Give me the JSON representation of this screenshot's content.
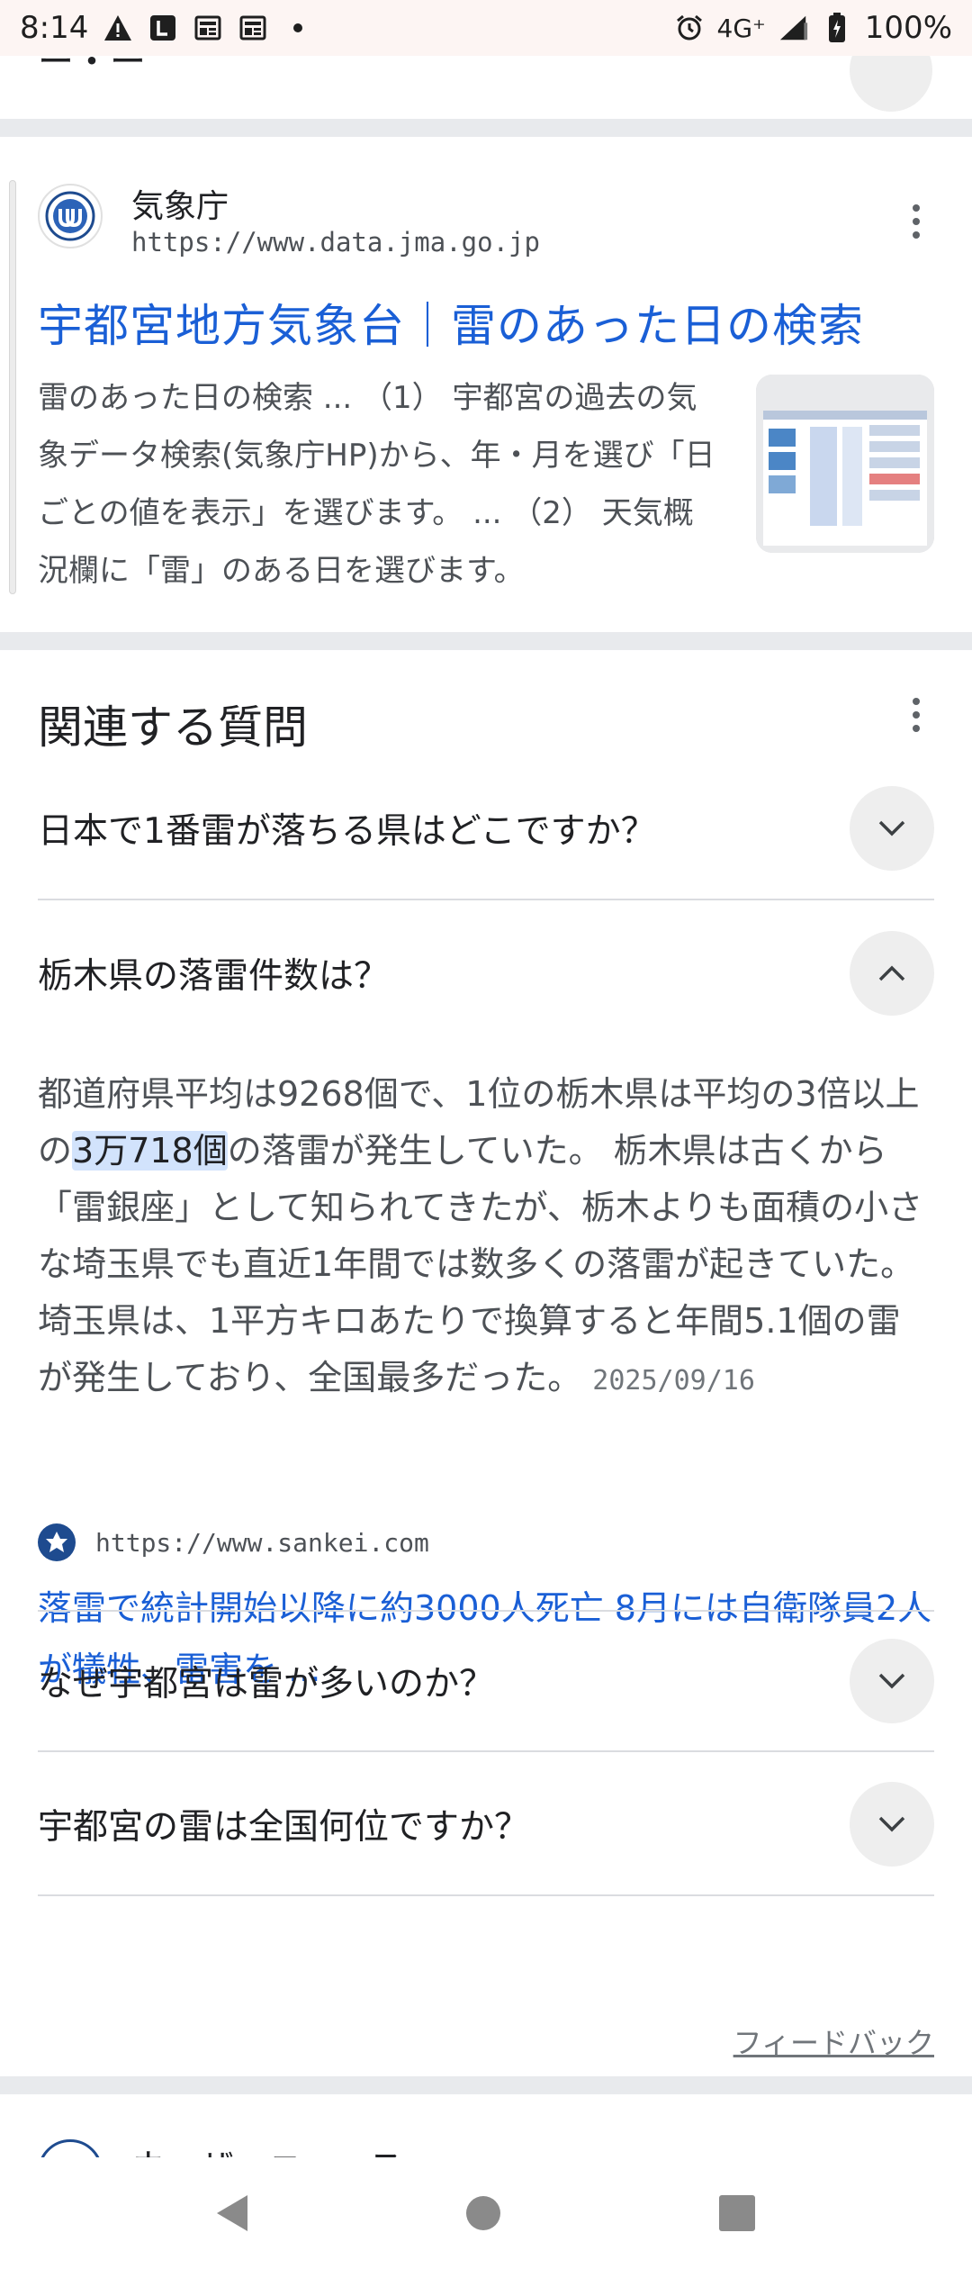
{
  "status_bar": {
    "time": "8:14",
    "network": "4G⁺",
    "battery": "100%"
  },
  "colors": {
    "link_blue": "#1a5fd6",
    "status_bg": "#fdf5f3",
    "separator": "#e8eaed",
    "highlight": "#d2e3fc"
  },
  "top_card": {
    "cut_title": "ー・ー"
  },
  "result": {
    "site_name": "気象庁",
    "site_url": "https://www.data.jma.go.jp",
    "title": "宇都宮地方気象台｜雷のあった日の検索",
    "snippet": "雷のあった日の検索 ... （1） 宇都宮の過去の気象データ検索(気象庁HP)から、年・月を選び「日ごとの値を表示」を選びます。 ... （2） 天気概況欄に「雷」のある日を選びます。"
  },
  "related": {
    "title": "関連する質問",
    "questions": [
      {
        "text": "日本で1番雷が落ちる県はどこですか？",
        "expanded": false
      },
      {
        "text": "栃木県の落雷件数は？",
        "expanded": true
      },
      {
        "text": "なぜ宇都宮は雷が多いのか？",
        "expanded": false
      },
      {
        "text": "宇都宮の雷は全国何位ですか？",
        "expanded": false
      }
    ],
    "answer": {
      "before": "都道府県平均は9268個で、1位の栃木県は平均の3倍以上の",
      "highlight": "3万718個",
      "after": "の落雷が発生していた。 栃木県は古くから「雷銀座」として知られてきたが、栃木よりも面積の小さな埼玉県でも直近1年間では数多くの落雷が起きていた。 埼玉県は、1平方キロあたりで換算すると年間5.1個の雷が発生しており、全国最多だった。",
      "date": "2025/09/16",
      "source_url": "https://www.sankei.com",
      "source_title": "落雷で統計開始以降に約3000人死亡 8月には自衛隊員2人が犠牲、雷害を ..."
    },
    "feedback": "フィードバック"
  },
  "bottom_card": {
    "cut_name": "ウェザーニュース"
  },
  "icons": {
    "more": "more-vert-icon",
    "expand": "chevron-down-icon",
    "collapse": "chevron-up-icon"
  }
}
